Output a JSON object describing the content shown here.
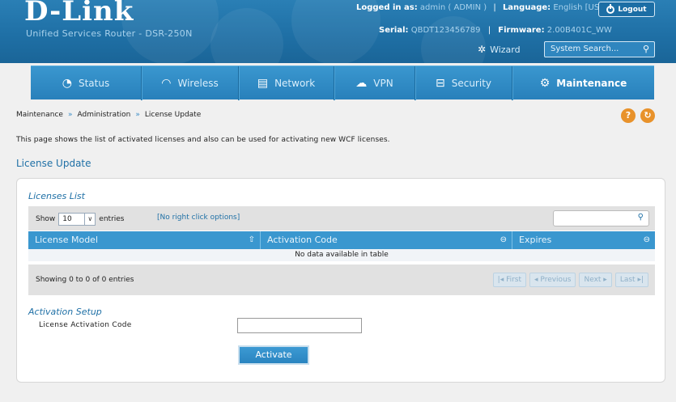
{
  "header": {
    "brand": "D-Link",
    "subtitle": "Unified Services Router - DSR-250N",
    "logged_in_label": "Logged in as:",
    "logged_in_value": "admin ( ADMIN )",
    "language_label": "Language:",
    "language_value": "English [US]",
    "logout_label": "Logout",
    "serial_label": "Serial:",
    "serial_value": "QBDT123456789",
    "firmware_label": "Firmware:",
    "firmware_value": "2.00B401C_WW",
    "wizard_label": "Wizard",
    "search_placeholder": "System Search..."
  },
  "nav": {
    "items": [
      {
        "label": "Status",
        "icon": "dashboard-icon"
      },
      {
        "label": "Wireless",
        "icon": "wifi-icon"
      },
      {
        "label": "Network",
        "icon": "monitor-icon"
      },
      {
        "label": "VPN",
        "icon": "cloud-lock-icon"
      },
      {
        "label": "Security",
        "icon": "lock-icon"
      },
      {
        "label": "Maintenance",
        "icon": "gears-icon",
        "active": true
      }
    ]
  },
  "breadcrumb": [
    "Maintenance",
    "Administration",
    "License Update"
  ],
  "description": "This page shows the list of activated licenses and also can be used for activating new WCF licenses.",
  "page_title": "License Update",
  "licenses": {
    "title": "Licenses List",
    "show_label": "Show",
    "entries_value": "10",
    "entries_label": "entries",
    "no_right_click": "[No right click options]",
    "columns": [
      "License Model",
      "Activation Code",
      "Expires"
    ],
    "empty_message": "No data available in table",
    "info": "Showing 0 to 0 of 0 entries",
    "pager": [
      "First",
      "Previous",
      "Next",
      "Last"
    ]
  },
  "activation": {
    "title": "Activation Setup",
    "field_label": "License Activation Code",
    "field_value": "",
    "button_label": "Activate"
  },
  "colors": {
    "brand_blue": "#1f70a6",
    "nav_blue": "#3a97cf",
    "help_orange": "#e8922b"
  }
}
